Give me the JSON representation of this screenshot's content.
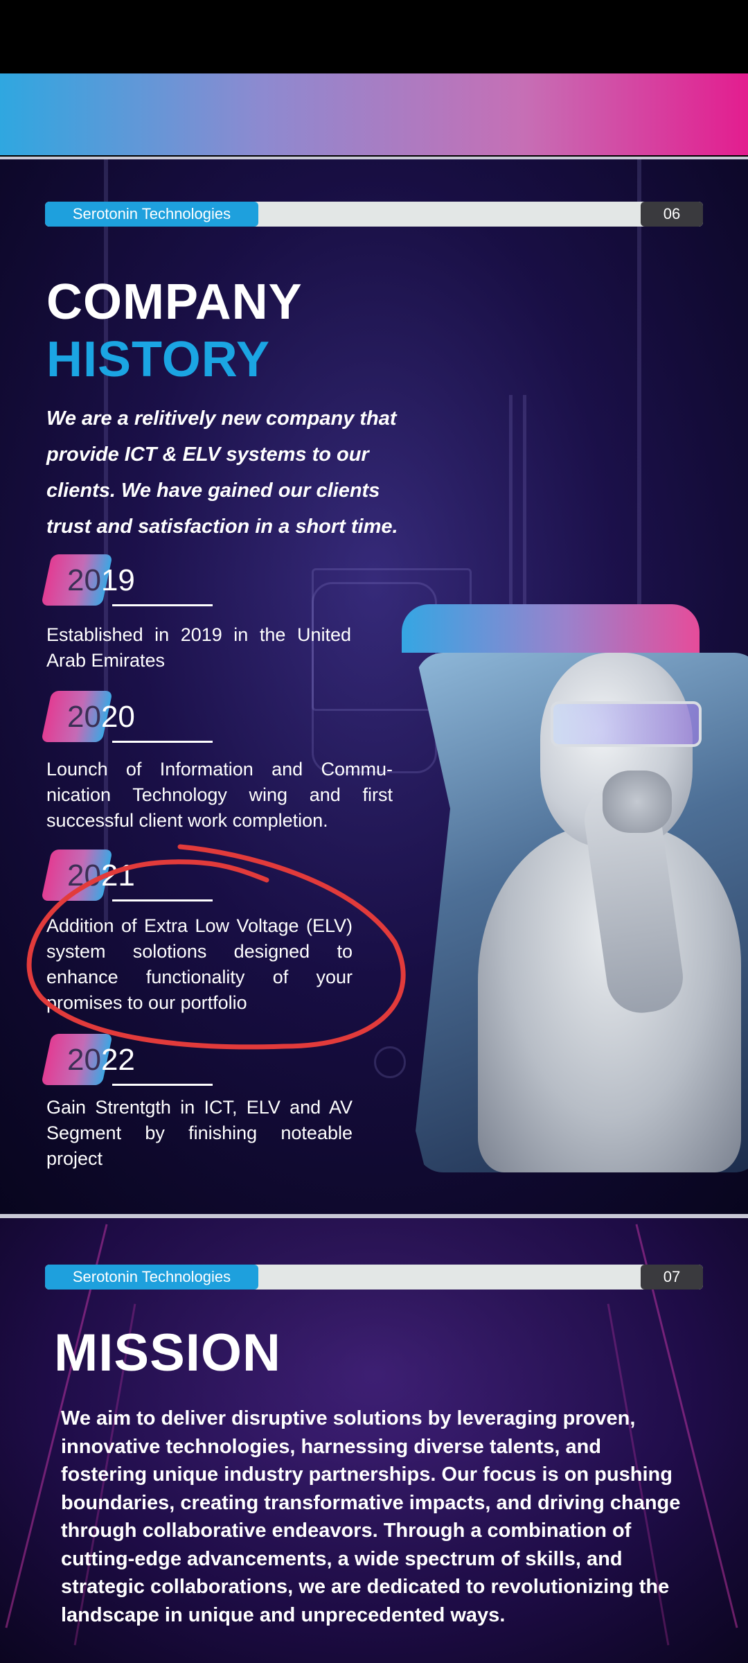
{
  "page1": {
    "brand": "Serotonin Technologies",
    "page_number": "06",
    "title_line1": "COMPANY",
    "title_line2": "HISTORY",
    "intro_lines": [
      "We are a relitively new company that",
      "provide ICT & ELV systems to our",
      "clients. We have gained our clients",
      "trust and satisfaction in a short time."
    ],
    "timeline": [
      {
        "year_prefix": "20",
        "year_suffix": "19",
        "description": "Established in 2019 in the United Arab Emirates"
      },
      {
        "year_prefix": "20",
        "year_suffix": "20",
        "description": "Lounch of Information and Commu-nication Technology wing and first successful client work completion."
      },
      {
        "year_prefix": "20",
        "year_suffix": "21",
        "description": "Addition of Extra Low Voltage (ELV) system solotions designed to enhance functionality of your promises to our portfolio"
      },
      {
        "year_prefix": "20",
        "year_suffix": "22",
        "description": "Gain Strentgth in ICT, ELV and AV Segment by finishing noteable project"
      }
    ],
    "image_subject": "humanoid-robot"
  },
  "page2": {
    "brand": "Serotonin Technologies",
    "page_number": "07",
    "title": "MISSION",
    "body": "We aim to deliver disruptive solutions by leveraging proven, innovative technologies, harnessing diverse talents, and fostering unique industry partnerships. Our focus is on pushing boundaries, creating transformative impacts, and driving change through collaborative endeavors. Through a combination of cutting-edge advancements, a wide spectrum of skills, and strategic collaborations, we are dedicated to revolutionizing the landscape in unique and unprecedented ways."
  },
  "colors": {
    "accent_blue": "#1ba5e3",
    "accent_pink": "#e31d8f",
    "annotation_red": "#e23b3b"
  }
}
